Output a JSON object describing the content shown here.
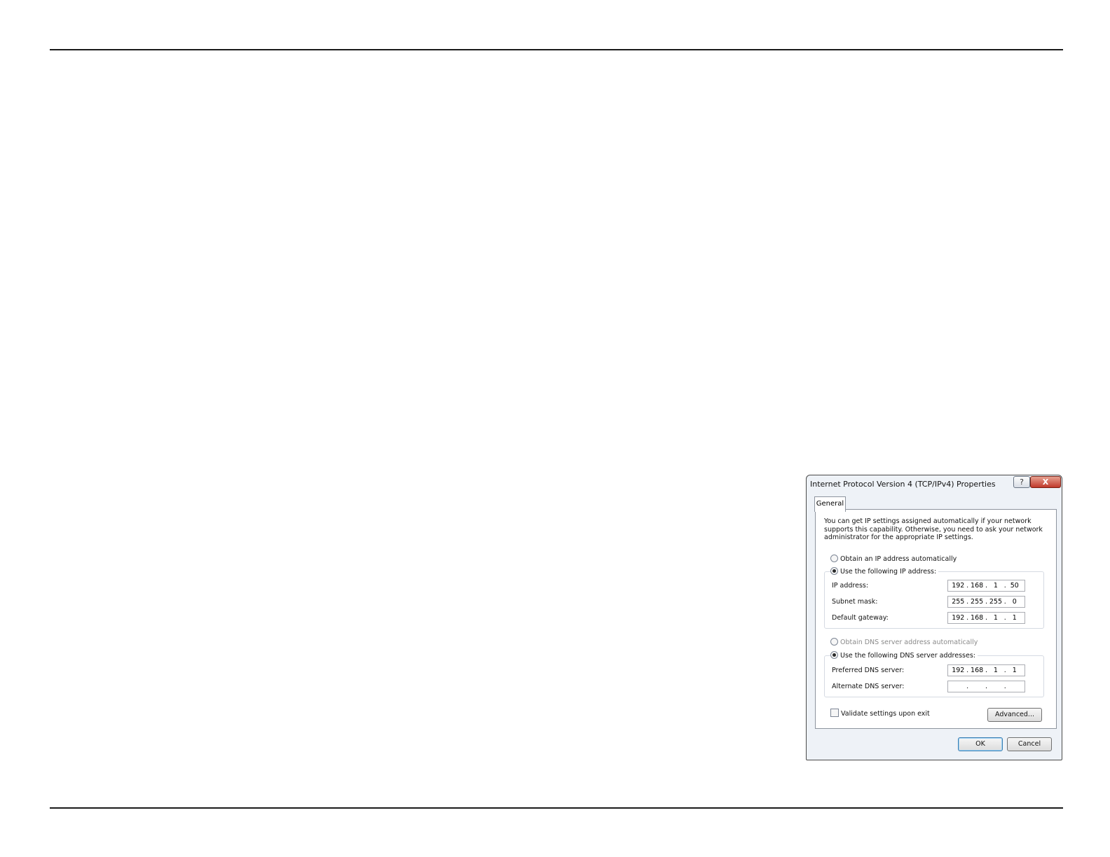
{
  "dialog": {
    "title": "Internet Protocol Version 4 (TCP/IPv4) Properties",
    "help_glyph": "?",
    "close_glyph": "X",
    "tab_label": "General",
    "intro_text": "You can get IP settings assigned automatically if your network supports this capability. Otherwise, you need to ask your network administrator for the appropriate IP settings.",
    "radio_obtain_ip": "Obtain an IP address automatically",
    "radio_use_ip": "Use the following IP address:",
    "ip_address": {
      "label": "IP address:",
      "octets": [
        "192",
        "168",
        "1",
        "50"
      ]
    },
    "subnet_mask": {
      "label": "Subnet mask:",
      "octets": [
        "255",
        "255",
        "255",
        "0"
      ]
    },
    "default_gateway": {
      "label": "Default gateway:",
      "octets": [
        "192",
        "168",
        "1",
        "1"
      ]
    },
    "radio_obtain_dns": "Obtain DNS server address automatically",
    "radio_use_dns": "Use the following DNS server addresses:",
    "preferred_dns": {
      "label": "Preferred DNS server:",
      "octets": [
        "192",
        "168",
        "1",
        "1"
      ]
    },
    "alternate_dns": {
      "label": "Alternate DNS server:",
      "octets": [
        "",
        "",
        "",
        ""
      ]
    },
    "validate_label": "Validate settings upon exit",
    "advanced_label": "Advanced...",
    "ok_label": "OK",
    "cancel_label": "Cancel"
  }
}
